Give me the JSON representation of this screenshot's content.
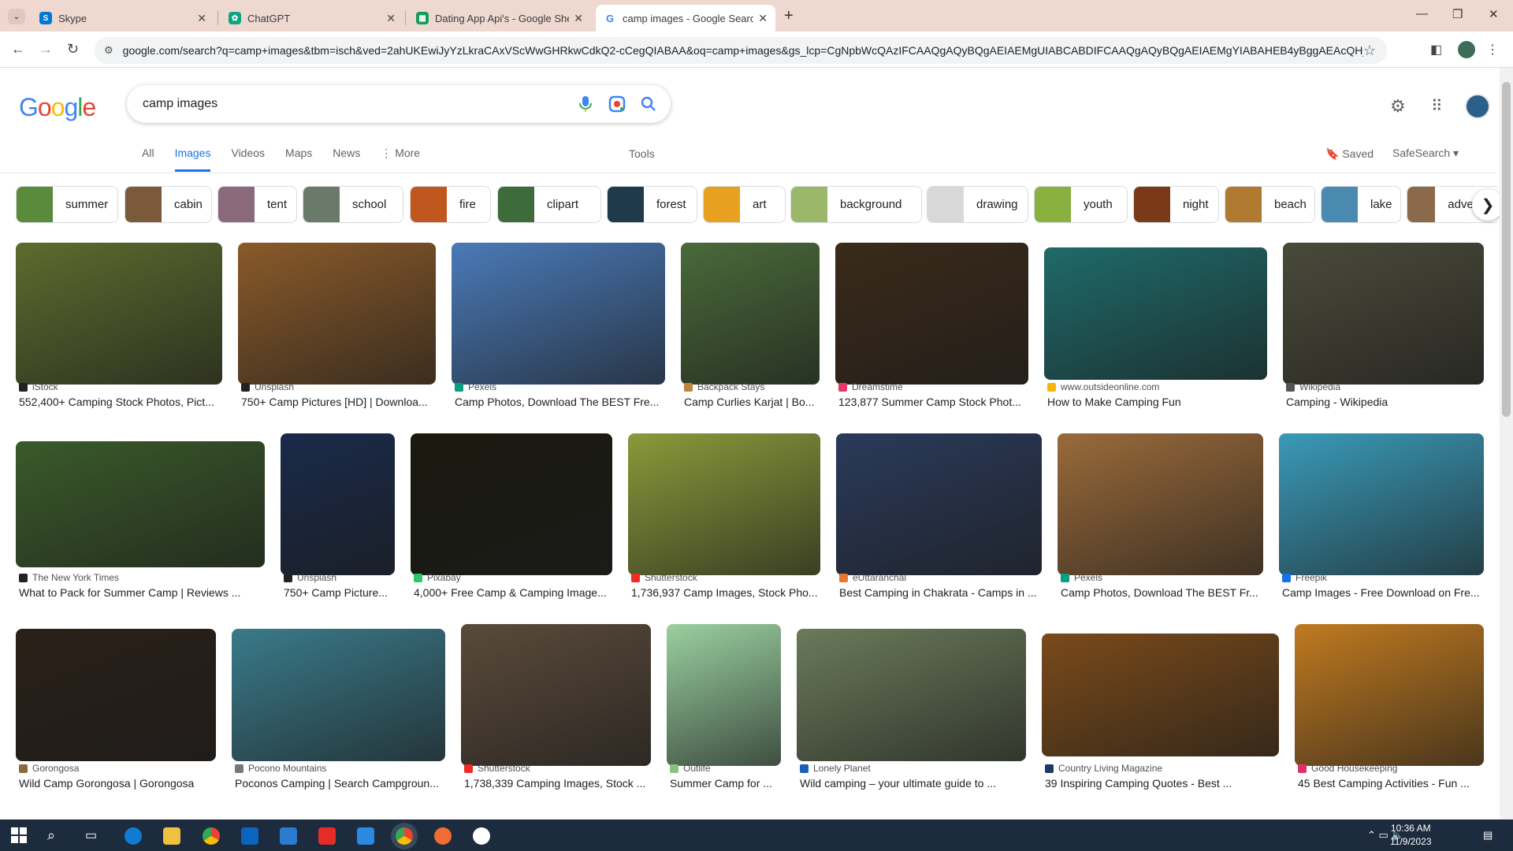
{
  "browser": {
    "tabs": [
      {
        "title": "Skype",
        "favicon": "skype-icon",
        "color": "#0078d4"
      },
      {
        "title": "ChatGPT",
        "favicon": "chatgpt-icon",
        "color": "#10a37f"
      },
      {
        "title": "Dating App Api's - Google She",
        "favicon": "sheets-icon",
        "color": "#0f9d58"
      },
      {
        "title": "camp images - Google Search",
        "favicon": "google-icon",
        "color": "#4285f4"
      }
    ],
    "url": "google.com/search?q=camp+images&tbm=isch&ved=2ahUKEwiJyYzLkraCAxVScWwGHRkwCdkQ2-cCegQIABAA&oq=camp+images&gs_lcp=CgNpbWcQAzIFCAAQgAQyBQgAEIAEMgUIABCABDIFCAAQgAQyBQgAEIAEMgYIABAHEB4yBggAEAcQHjIGCAAQBx..."
  },
  "google": {
    "logo": [
      "G",
      "o",
      "o",
      "g",
      "l",
      "e"
    ],
    "query": "camp images",
    "nav_tabs": [
      "All",
      "Images",
      "Videos",
      "Maps",
      "News",
      "More"
    ],
    "active_tab": "Images",
    "tools": "Tools",
    "saved": "Saved",
    "safesearch": "SafeSearch"
  },
  "chips": [
    {
      "label": "summer",
      "color": "#5a8a3c"
    },
    {
      "label": "cabin",
      "color": "#7a5a3a"
    },
    {
      "label": "tent",
      "color": "#8a6a7a"
    },
    {
      "label": "school",
      "color": "#6a7a6a"
    },
    {
      "label": "fire",
      "color": "#c0571e"
    },
    {
      "label": "clipart",
      "color": "#3d6b3a"
    },
    {
      "label": "forest",
      "color": "#1f3a4a"
    },
    {
      "label": "art",
      "color": "#e8a020"
    },
    {
      "label": "background",
      "color": "#9bb86a"
    },
    {
      "label": "drawing",
      "color": "#d8d8d8"
    },
    {
      "label": "youth",
      "color": "#8ab040"
    },
    {
      "label": "night",
      "color": "#7a3a1a"
    },
    {
      "label": "beach",
      "color": "#b07a30"
    },
    {
      "label": "lake",
      "color": "#4a8ab0"
    },
    {
      "label": "adventure",
      "color": "#8a6a4a"
    }
  ],
  "results": [
    {
      "source": "iStock",
      "caption": "552,400+ Camping Stock Photos, Pict...",
      "color": "#5d6b2e",
      "iconColor": "#222"
    },
    {
      "source": "Unsplash",
      "caption": "750+ Camp Pictures [HD] | Downloa...",
      "color": "#8a5a2a",
      "iconColor": "#222"
    },
    {
      "source": "Pexels",
      "caption": "Camp Photos, Download The BEST Fre...",
      "color": "#4a7ab8",
      "iconColor": "#05a081"
    },
    {
      "source": "Backpack Stays",
      "caption": "Camp Curlies Karjat | Bo...",
      "color": "#4a6a3a",
      "iconColor": "#c0843a"
    },
    {
      "source": "Dreamstime",
      "caption": "123,877 Summer Camp Stock Phot...",
      "color": "#3a2a1a",
      "iconColor": "#e03a6a"
    },
    {
      "source": "www.outsideonline.com",
      "caption": "How to Make Camping Fun",
      "color": "#1f6a6a",
      "iconColor": "#f2b70a"
    },
    {
      "source": "Wikipedia",
      "caption": "Camping - Wikipedia",
      "color": "#4a4a3a",
      "iconColor": "#555"
    },
    {
      "source": "The New York Times",
      "caption": "What to Pack for Summer Camp | Reviews ...",
      "color": "#3a5a2a",
      "iconColor": "#222"
    },
    {
      "source": "Unsplash",
      "caption": "750+ Camp Picture...",
      "color": "#1a2a4a",
      "iconColor": "#222"
    },
    {
      "source": "Pixabay",
      "caption": "4,000+ Free Camp & Camping Image...",
      "color": "#1a1a10",
      "iconColor": "#2ec66d"
    },
    {
      "source": "Shutterstock",
      "caption": "1,736,937 Camp Images, Stock Pho...",
      "color": "#8a9a3a",
      "iconColor": "#ee2b24"
    },
    {
      "source": "eUttaranchal",
      "caption": "Best Camping in Chakrata - Camps in ...",
      "color": "#2a3a5a",
      "iconColor": "#e8772e"
    },
    {
      "source": "Pexels",
      "caption": "Camp Photos, Download The BEST Fr...",
      "color": "#9a6a3a",
      "iconColor": "#05a081"
    },
    {
      "source": "Freepik",
      "caption": "Camp Images - Free Download on Fre...",
      "color": "#3a9ab8",
      "iconColor": "#1273eb"
    },
    {
      "source": "Gorongosa",
      "caption": "Wild Camp Gorongosa | Gorongosa",
      "color": "#2a2018",
      "iconColor": "#8a6a3a"
    },
    {
      "source": "Pocono Mountains",
      "caption": "Poconos Camping | Search Campgroun...",
      "color": "#3a7a8a",
      "iconColor": "#777"
    },
    {
      "source": "Shutterstock",
      "caption": "1,738,339 Camping Images, Stock ...",
      "color": "#5a4a3a",
      "iconColor": "#ee2b24"
    },
    {
      "source": "Outlife",
      "caption": "Summer Camp for ...",
      "color": "#9ad0a0",
      "iconColor": "#8ac080"
    },
    {
      "source": "Lonely Planet",
      "caption": "Wild camping – your ultimate guide to ...",
      "color": "#6a7a5a",
      "iconColor": "#1a5fb4"
    },
    {
      "source": "Country Living Magazine",
      "caption": "39 Inspiring Camping Quotes - Best ...",
      "color": "#7a4a1a",
      "iconColor": "#1a3a6a"
    },
    {
      "source": "Good Housekeeping",
      "caption": "45 Best Camping Activities - Fun ...",
      "color": "#c07a20",
      "iconColor": "#e0306a"
    }
  ],
  "taskbar": {
    "time": "10:36 AM",
    "date": "11/9/2023",
    "icons": [
      "windows-start-icon",
      "search-icon",
      "task-view-icon",
      "edge-icon",
      "file-explorer-icon",
      "chrome-icon",
      "store-icon",
      "mail-icon",
      "youtube-icon",
      "vscode-icon",
      "chrome-active-icon",
      "postman-icon",
      "app-icon"
    ]
  }
}
